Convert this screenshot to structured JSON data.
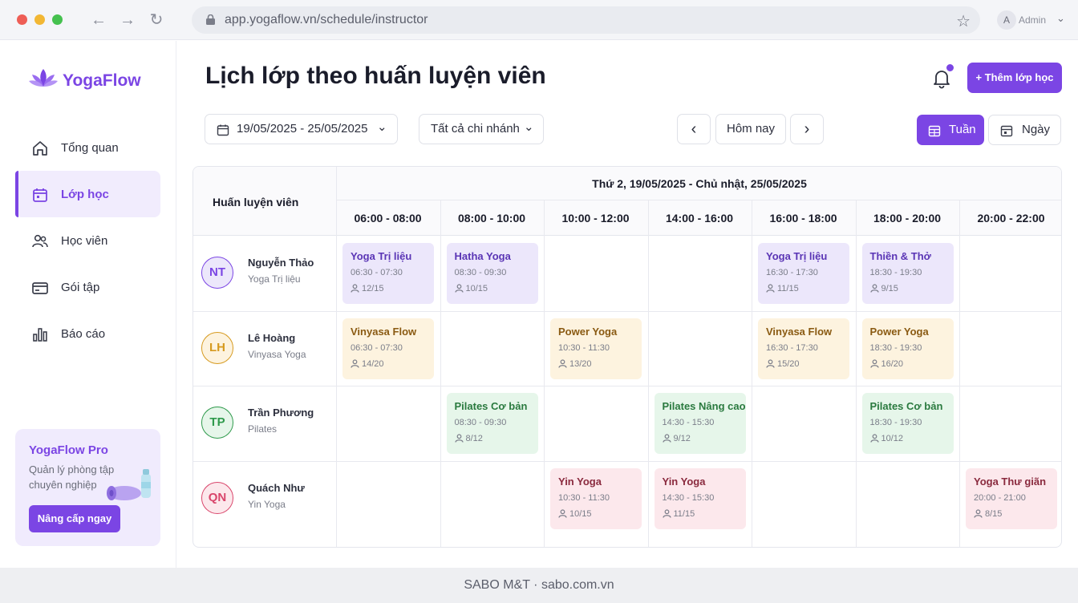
{
  "browser": {
    "url": "app.yogaflow.vn/schedule/instructor",
    "account_initial": "A",
    "account_name": "Admin"
  },
  "brand": {
    "name": "YogaFlow",
    "accent": "#7b45e4"
  },
  "sidebar": {
    "items": [
      {
        "label": "Tổng quan",
        "icon": "home-icon"
      },
      {
        "label": "Lớp học",
        "icon": "calendar-icon",
        "active": true
      },
      {
        "label": "Học viên",
        "icon": "users-icon"
      },
      {
        "label": "Gói tập",
        "icon": "card-icon"
      },
      {
        "label": "Báo cáo",
        "icon": "chart-icon"
      }
    ],
    "promo": {
      "title": "YogaFlow Pro",
      "desc": "Quản lý phòng tập chuyên nghiệp",
      "button": "Nâng cấp ngay"
    }
  },
  "page": {
    "title": "Lịch lớp theo huấn luyện viên",
    "add_button": "+ Thêm lớp học"
  },
  "filters": {
    "date_range": "19/05/2025 - 25/05/2025",
    "branch": "Tất cả chi nhánh",
    "today": "Hôm nay",
    "view_week": "Tuần",
    "view_day": "Ngày"
  },
  "schedule": {
    "instructor_header": "Huấn luyện viên",
    "range_header": "Thứ 2, 19/05/2025 - Chủ nhật, 25/05/2025",
    "slots": [
      "06:00 - 08:00",
      "08:00 - 10:00",
      "10:00 - 12:00",
      "14:00 - 16:00",
      "16:00 - 18:00",
      "18:00 - 20:00",
      "20:00 - 22:00"
    ],
    "instructors": [
      {
        "initials": "NT",
        "name": "Nguyễn Thảo",
        "specialty": "Yoga Trị liệu",
        "color": "#7b45e4",
        "bg": "#ece7fb"
      },
      {
        "initials": "LH",
        "name": "Lê Hoàng",
        "specialty": "Vinyasa Yoga",
        "color": "#d69a1f",
        "bg": "#fdf3df"
      },
      {
        "initials": "TP",
        "name": "Trần Phương",
        "specialty": "Pilates",
        "color": "#2f9a4c",
        "bg": "#e6f6ea"
      },
      {
        "initials": "QN",
        "name": "Quách Như",
        "specialty": "Yin Yoga",
        "color": "#d9456b",
        "bg": "#fce8ec"
      }
    ],
    "classes": [
      {
        "row": 0,
        "slot": 0,
        "name": "Yoga Trị liệu",
        "time": "06:30 - 07:30",
        "count": "12/15",
        "theme": "purple"
      },
      {
        "row": 0,
        "slot": 1,
        "name": "Hatha Yoga",
        "time": "08:30 - 09:30",
        "count": "10/15",
        "theme": "purple"
      },
      {
        "row": 0,
        "slot": 4,
        "name": "Yoga Trị liệu",
        "time": "16:30 - 17:30",
        "count": "11/15",
        "theme": "purple"
      },
      {
        "row": 0,
        "slot": 5,
        "name": "Thiền & Thở",
        "time": "18:30 - 19:30",
        "count": "9/15",
        "theme": "purple"
      },
      {
        "row": 1,
        "slot": 0,
        "name": "Vinyasa Flow",
        "time": "06:30 - 07:30",
        "count": "14/20",
        "theme": "orange"
      },
      {
        "row": 1,
        "slot": 2,
        "name": "Power Yoga",
        "time": "10:30 - 11:30",
        "count": "13/20",
        "theme": "orange"
      },
      {
        "row": 1,
        "slot": 4,
        "name": "Vinyasa Flow",
        "time": "16:30 - 17:30",
        "count": "15/20",
        "theme": "orange"
      },
      {
        "row": 1,
        "slot": 5,
        "name": "Power Yoga",
        "time": "18:30 - 19:30",
        "count": "16/20",
        "theme": "orange"
      },
      {
        "row": 2,
        "slot": 1,
        "name": "Pilates Cơ bản",
        "time": "08:30 - 09:30",
        "count": "8/12",
        "theme": "green"
      },
      {
        "row": 2,
        "slot": 3,
        "name": "Pilates Nâng cao",
        "time": "14:30 - 15:30",
        "count": "9/12",
        "theme": "green"
      },
      {
        "row": 2,
        "slot": 5,
        "name": "Pilates Cơ bản",
        "time": "18:30 - 19:30",
        "count": "10/12",
        "theme": "green"
      },
      {
        "row": 3,
        "slot": 2,
        "name": "Yin Yoga",
        "time": "10:30 - 11:30",
        "count": "10/15",
        "theme": "pink"
      },
      {
        "row": 3,
        "slot": 3,
        "name": "Yin Yoga",
        "time": "14:30 - 15:30",
        "count": "11/15",
        "theme": "pink"
      },
      {
        "row": 3,
        "slot": 6,
        "name": "Yoga Thư giãn",
        "time": "20:00 - 21:00",
        "count": "8/15",
        "theme": "pink"
      }
    ]
  },
  "footer": "SABO M&T · sabo.com.vn"
}
